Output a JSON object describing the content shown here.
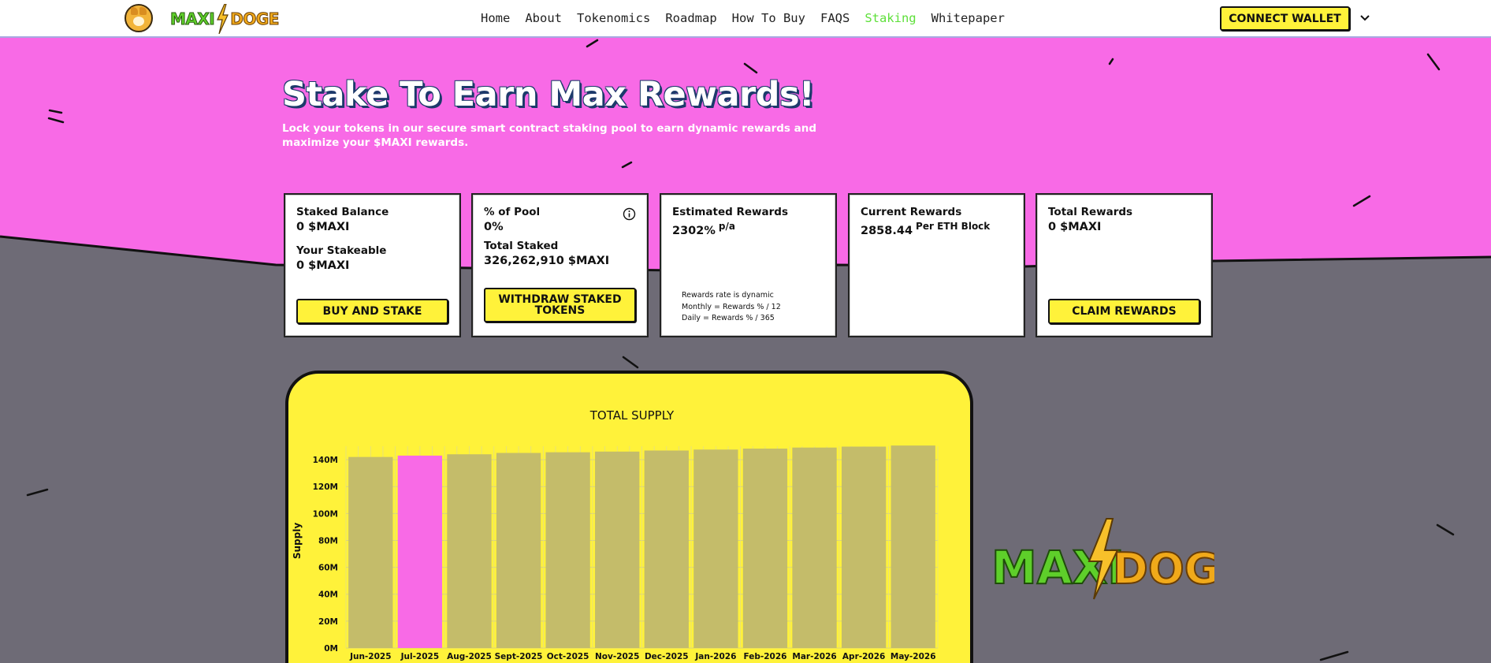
{
  "header": {
    "nav": [
      "Home",
      "About",
      "Tokenomics",
      "Roadmap",
      "How To Buy",
      "FAQS",
      "Staking",
      "Whitepaper"
    ],
    "active_index": 6,
    "connect_label": "CONNECT WALLET",
    "logo": {
      "part1": "MAXI",
      "part2": "DOGE"
    }
  },
  "hero": {
    "title": "Stake To Earn Max Rewards!",
    "subtitle": "Lock your tokens in our secure smart contract staking pool to earn dynamic rewards and maximize your $MAXI rewards."
  },
  "cards": {
    "staked": {
      "label": "Staked Balance",
      "value": "0 $MAXI",
      "label2": "Your Stakeable",
      "value2": "0 $MAXI",
      "button": "BUY AND STAKE"
    },
    "pool": {
      "label": "% of Pool",
      "value": "0%",
      "label2": "Total Staked",
      "value2": "326,262,910 $MAXI",
      "button": "WITHDRAW STAKED TOKENS"
    },
    "estimated": {
      "label": "Estimated Rewards",
      "value": "2302%",
      "suffix": "p/a",
      "note": [
        "Rewards rate is dynamic",
        "Monthly = Rewards % / 12",
        "Daily = Rewards % / 365"
      ]
    },
    "current": {
      "label": "Current Rewards",
      "value": "2858.44",
      "suffix": "Per ETH Block"
    },
    "total": {
      "label": "Total Rewards",
      "value": "0 $MAXI",
      "button": "CLAIM REWARDS"
    }
  },
  "colors": {
    "pink": "#f86ae6",
    "yellow": "#fff23a",
    "bar": "#c4bc6a",
    "highlight": "#f86ae6",
    "gray": "#6e6b76"
  },
  "chart_data": {
    "type": "bar",
    "title": "TOTAL SUPPLY",
    "ylabel": "Supply",
    "categories": [
      "Jun-2025",
      "Jul-2025",
      "Aug-2025",
      "Sept-2025",
      "Oct-2025",
      "Nov-2025",
      "Dec-2025",
      "Jan-2026",
      "Feb-2026",
      "Mar-2026",
      "Apr-2026",
      "May-2026"
    ],
    "values": [
      142,
      143,
      144,
      145,
      145.5,
      146,
      146.8,
      147.5,
      148.2,
      149,
      149.7,
      150.5
    ],
    "highlight_index": 1,
    "yticks": [
      "0M",
      "20M",
      "40M",
      "60M",
      "80M",
      "100M",
      "120M",
      "140M"
    ],
    "ylim": [
      0,
      150
    ],
    "grid": true
  }
}
